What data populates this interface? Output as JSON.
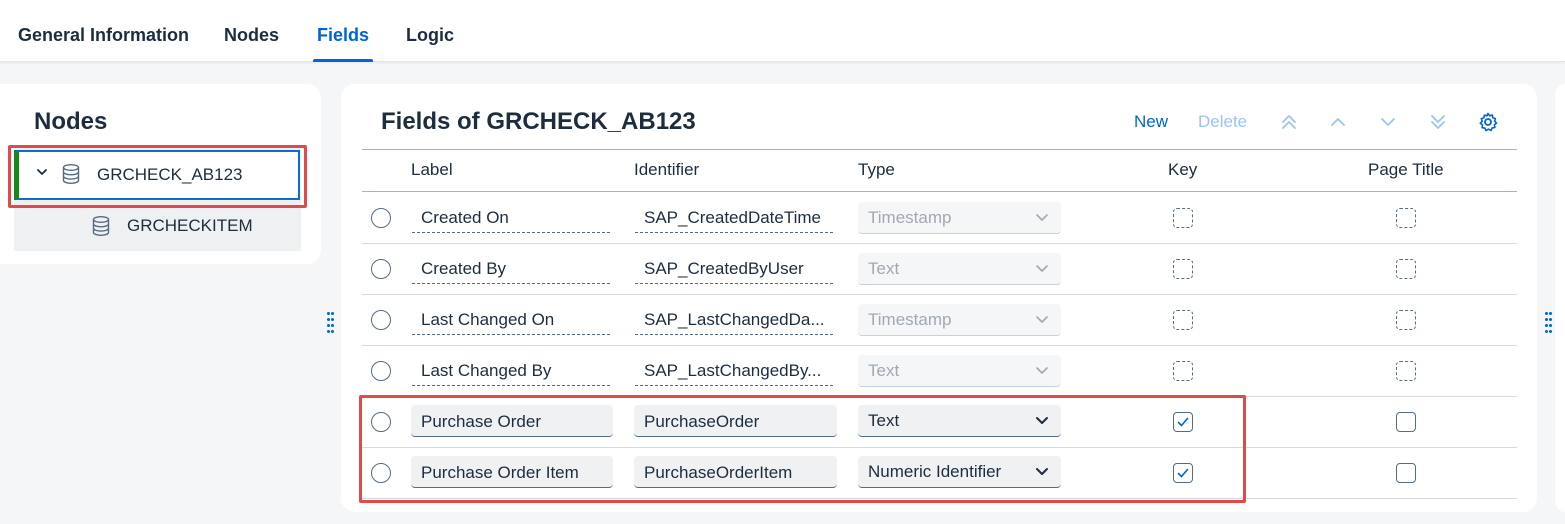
{
  "tabs": [
    {
      "label": "General Information",
      "active": false
    },
    {
      "label": "Nodes",
      "active": false
    },
    {
      "label": "Fields",
      "active": true
    },
    {
      "label": "Logic",
      "active": false
    }
  ],
  "nodes_panel": {
    "title": "Nodes",
    "items": [
      {
        "label": "GRCHECK_AB123",
        "expanded": true,
        "selected": true
      },
      {
        "label": "GRCHECKITEM",
        "expanded": false,
        "selected": false
      }
    ]
  },
  "fields_panel": {
    "title": "Fields of GRCHECK_AB123",
    "toolbar": {
      "new_label": "New",
      "delete_label": "Delete",
      "icons": [
        "move-to-top-icon",
        "move-up-icon",
        "move-down-icon",
        "move-to-bottom-icon",
        "settings-gear-icon"
      ]
    },
    "columns": {
      "label": "Label",
      "identifier": "Identifier",
      "type": "Type",
      "key": "Key",
      "page_title": "Page Title"
    },
    "rows": [
      {
        "label": "Created On",
        "identifier": "SAP_CreatedDateTime",
        "type": "Timestamp",
        "editable": false,
        "key": false,
        "page_title": false
      },
      {
        "label": "Created By",
        "identifier": "SAP_CreatedByUser",
        "type": "Text",
        "editable": false,
        "key": false,
        "page_title": false
      },
      {
        "label": "Last Changed On",
        "identifier": "SAP_LastChangedDa...",
        "type": "Timestamp",
        "editable": false,
        "key": false,
        "page_title": false
      },
      {
        "label": "Last Changed By",
        "identifier": "SAP_LastChangedBy...",
        "type": "Text",
        "editable": false,
        "key": false,
        "page_title": false
      },
      {
        "label": "Purchase Order",
        "identifier": "PurchaseOrder",
        "type": "Text",
        "editable": true,
        "key": true,
        "page_title": false
      },
      {
        "label": "Purchase Order Item",
        "identifier": "PurchaseOrderItem",
        "type": "Numeric Identifier",
        "editable": true,
        "key": true,
        "page_title": false
      }
    ]
  },
  "colors": {
    "accent": "#0064d9",
    "highlight_border": "#e04a4a",
    "selection_marker": "#188918"
  }
}
